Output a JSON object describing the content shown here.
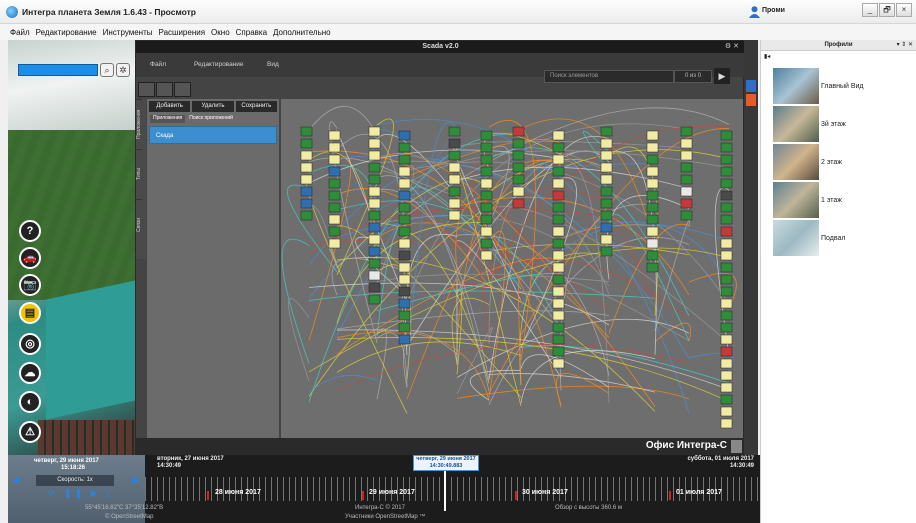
{
  "window": {
    "title": "Интегра планета Земля 1.6.43 - Просмотр",
    "user": "Проми",
    "controls": [
      "_",
      "🗗",
      "×"
    ]
  },
  "menu": [
    "Файл",
    "Редактирование",
    "Инструменты",
    "Расширения",
    "Окно",
    "Справка",
    "Дополнительно"
  ],
  "map": {
    "tools": [
      {
        "name": "help",
        "glyph": "?"
      },
      {
        "name": "vehicle",
        "glyph": "🚗"
      },
      {
        "name": "camera",
        "glyph": "📷"
      },
      {
        "name": "building",
        "glyph": "▤"
      },
      {
        "name": "ring",
        "glyph": "◎"
      },
      {
        "name": "weather",
        "glyph": "☁"
      },
      {
        "name": "satellite",
        "glyph": "◐"
      },
      {
        "name": "alarm",
        "glyph": "⚠"
      }
    ]
  },
  "scada": {
    "title": "Scada v2.0",
    "title_controls": "⚙ ✕",
    "menu": [
      "Файл",
      "Редактирование",
      "Вид"
    ],
    "search_placeholder": "Поиск элементов",
    "count": "0 из 0",
    "play": "▶",
    "left_tabs": [
      "Приложения",
      "Типы",
      "Связи"
    ],
    "panel_buttons": [
      "Добавить",
      "Удалить",
      "Сохранить"
    ],
    "panel_tabs": [
      "Приложения",
      "Поиск приложений"
    ],
    "panel_item": "Скада",
    "object_name": "Офис Интегра-С"
  },
  "profiles": {
    "title": "Профили",
    "controls": "▾ ⇕ ✕",
    "toolbar": "▮◂",
    "items": [
      {
        "label": "Главный Вид",
        "color": "#6f8fa6"
      },
      {
        "label": "3й этаж",
        "color": "#8c7a5e"
      },
      {
        "label": "2 этаж",
        "color": "#9c8466"
      },
      {
        "label": "1 этаж",
        "color": "#7e8c72"
      },
      {
        "label": "Подвал",
        "color": "#a9c2c9"
      }
    ]
  },
  "timeline": {
    "current_date": "четверг, 29 июня 2017",
    "current_time": "15:18:26",
    "speed": "Скорость: 1x",
    "controls": "⟳ ❚❚ ▶ ⤓",
    "left_label_date": "вторник, 27 июня 2017",
    "left_label_time": "14:30:49",
    "cursor_date": "четверг, 29 июня 2017",
    "cursor_time": "14:30:49.883",
    "right_label_date": "суббота, 01 июля 2017",
    "right_label_time": "14:30:49",
    "days": [
      "28 июня 2017",
      "29 июня 2017",
      "30 июня 2017",
      "01 июля 2017"
    ],
    "footer_left": "55°45'16.82\"С 37°35'12.82\"В",
    "footer_left2": "© OpenStreetMap",
    "footer_mid": "Интегра-С © 2017",
    "footer_mid2": "Участники OpenStreetMap ™",
    "footer_right": "Обзор с высоты 360.6 м"
  },
  "colors": {
    "accent": "#1e8de6",
    "scada_bg": "#6e6e6e",
    "node_green": "#2f8d3a",
    "node_yellow": "#f2eba2"
  }
}
